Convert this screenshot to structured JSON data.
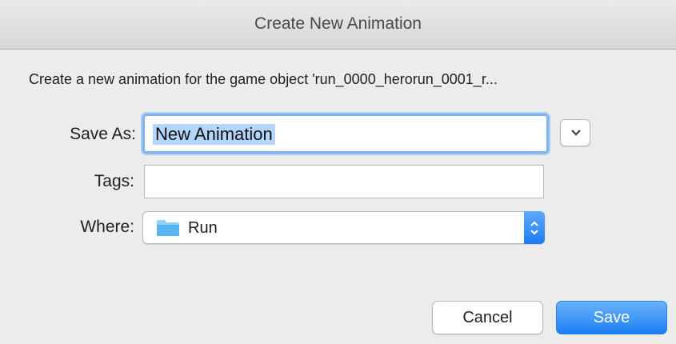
{
  "window": {
    "title": "Create New Animation"
  },
  "dialog": {
    "message": "Create a new animation for the game object 'run_0000_herorun_0001_r...",
    "save_as": {
      "label": "Save As:",
      "value": "New Animation"
    },
    "tags": {
      "label": "Tags:",
      "value": ""
    },
    "where": {
      "label": "Where:",
      "selected": "Run",
      "icon": "folder-icon"
    },
    "buttons": {
      "cancel": "Cancel",
      "save": "Save"
    }
  },
  "colors": {
    "accent": "#1b7ff5",
    "selection": "#b4d5fe",
    "focus_ring": "#7fb2ee",
    "folder": "#5ab4f0"
  }
}
